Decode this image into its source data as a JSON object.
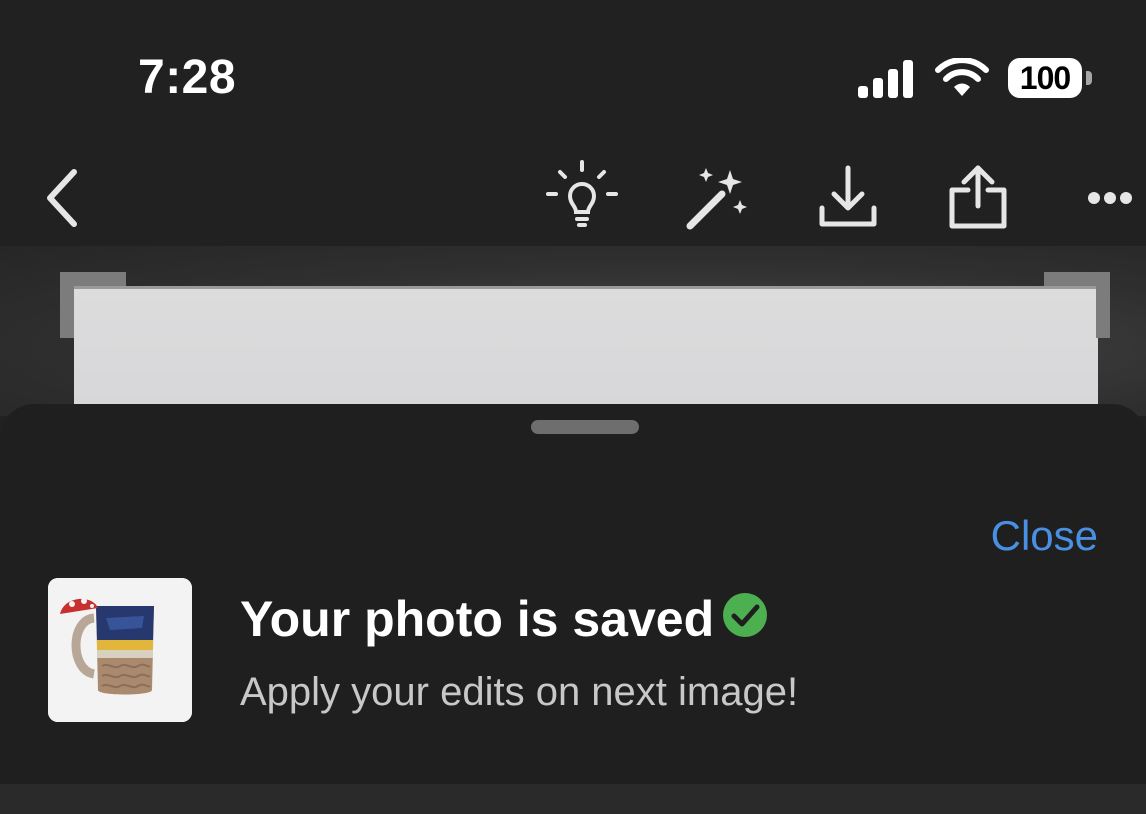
{
  "status_bar": {
    "time": "7:28",
    "battery": "100",
    "signal_icon": "cellular-signal-icon",
    "wifi_icon": "wifi-icon"
  },
  "toolbar": {
    "back_icon": "back-chevron-icon",
    "icons": [
      "lightbulb-icon",
      "magic-wand-icon",
      "download-icon",
      "share-icon",
      "more-icon"
    ]
  },
  "sheet": {
    "close_label": "Close",
    "title": "Your photo is saved",
    "subtitle": "Apply your edits on next image!",
    "status_icon": "check-circle-icon"
  },
  "colors": {
    "background": "#212121",
    "sheet": "#1f1f1f",
    "accent": "#4a90e2",
    "success": "#4caf50",
    "text_primary": "#ffffff",
    "text_secondary": "#c8c8c8"
  }
}
